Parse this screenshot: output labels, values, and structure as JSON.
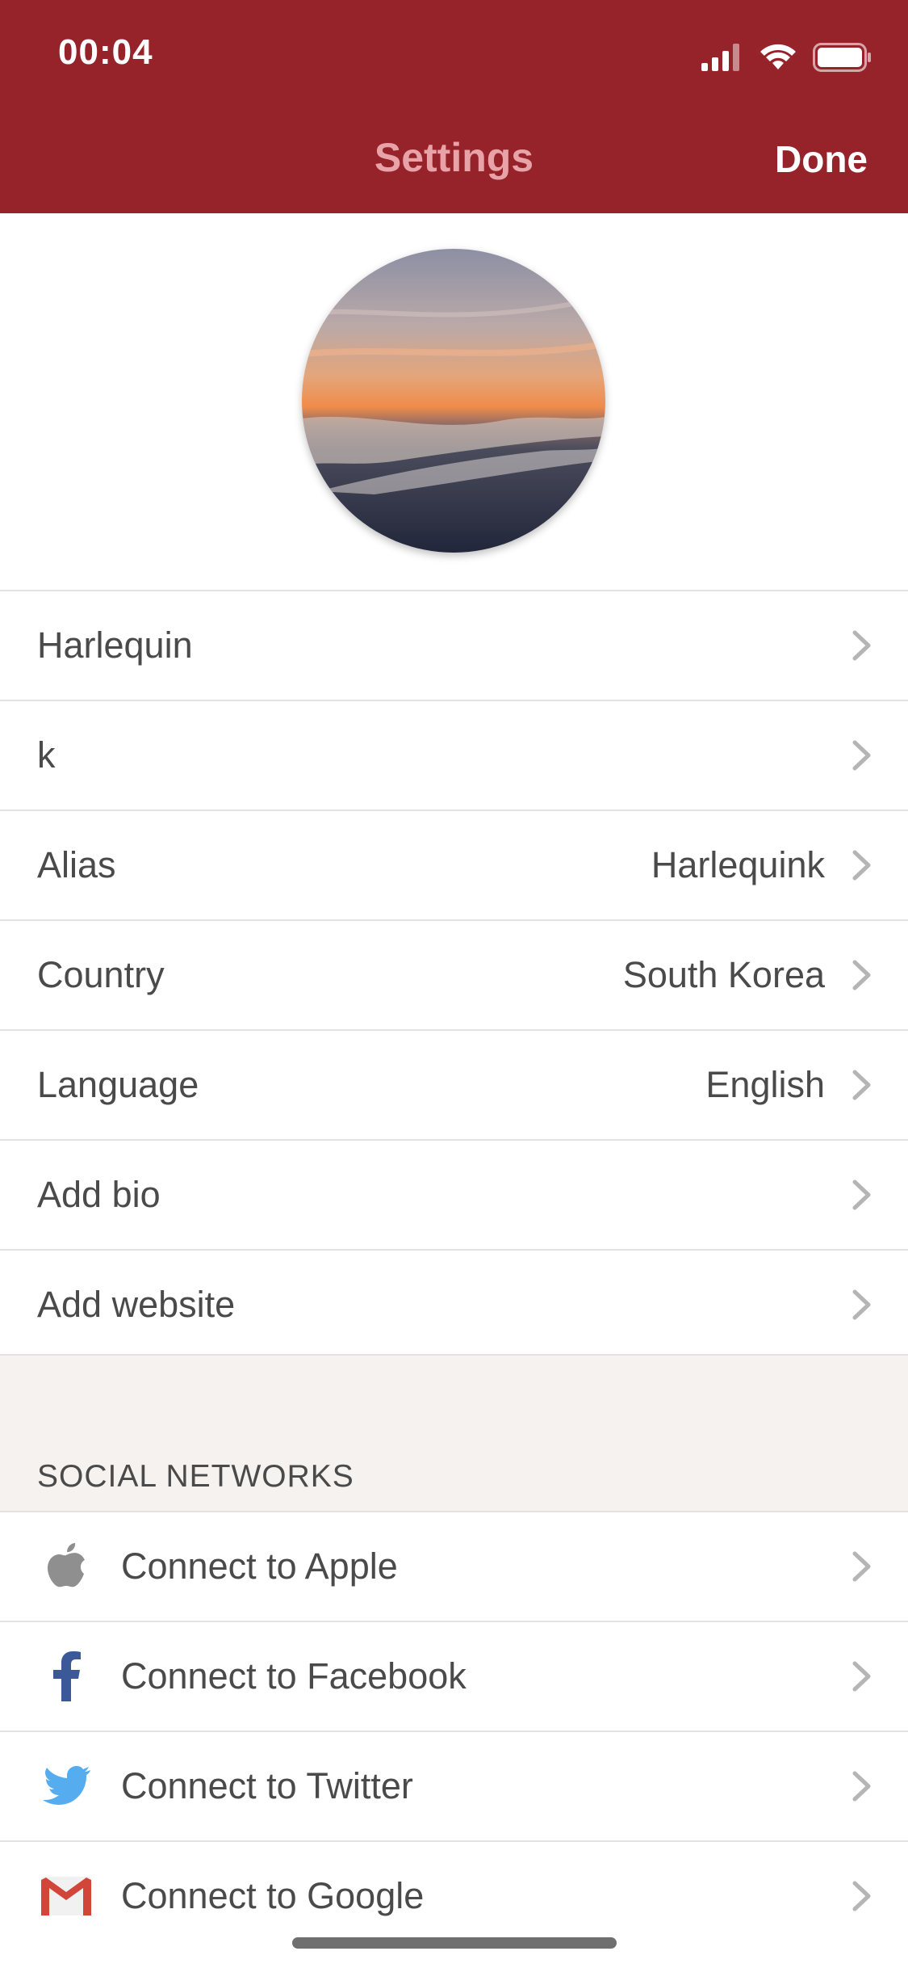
{
  "status_bar": {
    "time": "00:04"
  },
  "header": {
    "title": "Settings",
    "done_label": "Done"
  },
  "profile_rows": [
    {
      "label": "Harlequin",
      "value": ""
    },
    {
      "label": "k",
      "value": ""
    },
    {
      "label": "Alias",
      "value": "Harlequink"
    },
    {
      "label": "Country",
      "value": "South Korea"
    },
    {
      "label": "Language",
      "value": "English"
    },
    {
      "label": "Add bio",
      "value": ""
    },
    {
      "label": "Add website",
      "value": ""
    }
  ],
  "social": {
    "section_title": "SOCIAL NETWORKS",
    "items": [
      {
        "label": "Connect to Apple",
        "icon": "apple-icon"
      },
      {
        "label": "Connect to Facebook",
        "icon": "facebook-icon"
      },
      {
        "label": "Connect to Twitter",
        "icon": "twitter-icon"
      },
      {
        "label": "Connect to Google",
        "icon": "gmail-icon"
      }
    ]
  },
  "colors": {
    "header_bg": "#96222a",
    "title": "#e7a3a8",
    "section_bg": "#f5f2ef"
  }
}
